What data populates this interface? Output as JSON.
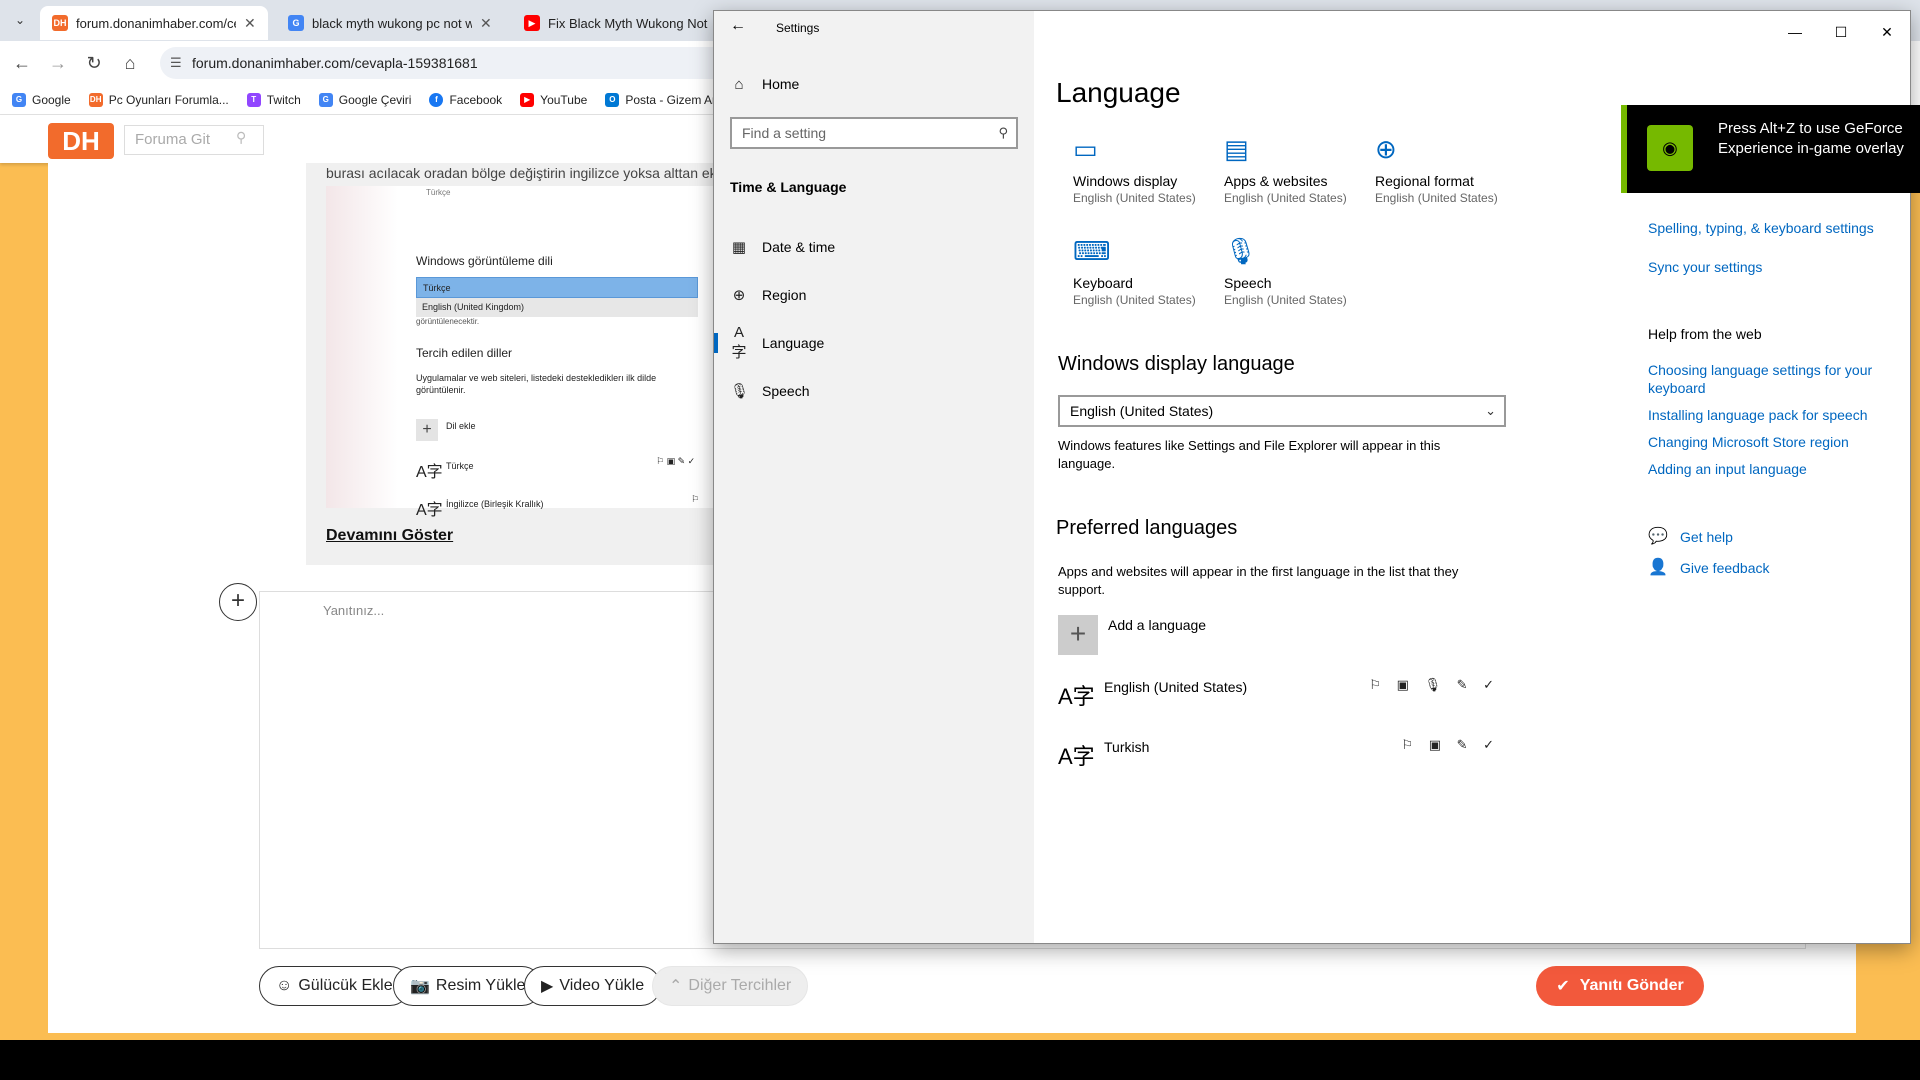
{
  "browser": {
    "tabs": [
      {
        "title": "forum.donanimhaber.com/ceva",
        "favicon": "DH",
        "color": "#f26b2c",
        "active": true
      },
      {
        "title": "black myth wukong pc not wor",
        "favicon": "G",
        "color": "#4285f4",
        "active": false
      },
      {
        "title": "Fix Black Myth Wukong Not La",
        "favicon": "▶",
        "color": "#ff0000",
        "active": false
      }
    ],
    "url": "forum.donanimhaber.com/cevapla-159381681",
    "bookmarks": [
      {
        "label": "Google",
        "icon": "G",
        "color": "#4285f4"
      },
      {
        "label": "Pc Oyunları Forumla...",
        "icon": "DH",
        "color": "#f26b2c"
      },
      {
        "label": "Twitch",
        "icon": "T",
        "color": "#9146ff"
      },
      {
        "label": "Google Çeviri",
        "icon": "G",
        "color": "#4285f4"
      },
      {
        "label": "Facebook",
        "icon": "f",
        "color": "#1877f2"
      },
      {
        "label": "YouTube",
        "icon": "▶",
        "color": "#ff0000"
      },
      {
        "label": "Posta - Gizem Arc",
        "icon": "O",
        "color": "#0078d4"
      }
    ]
  },
  "forum": {
    "logo": "DH",
    "search_placeholder": "Foruma Git",
    "quote_text": "burası acılacak oradan bölge değiştirin ingilizce yoksa alttan ekle y",
    "quote_image": {
      "top_label": "Türkçe",
      "heading1": "Windows görüntüleme dili",
      "selected": "Türkçe",
      "option": "English (United Kingdom)",
      "cut_text": "görüntülenecektir.",
      "heading2": "Tercih edilen diller",
      "desc": "Uygulamalar ve web siteleri, listedeki desteklediklerı ilk dilde görüntülenir.",
      "add": "Dil ekle",
      "lang1": "Türkçe",
      "lang2": "İngilizce (Birleşik Krallık)"
    },
    "show_more": "Devamını Göster",
    "reply_placeholder": "Yanıtınız...",
    "buttons": {
      "emoji": "Gülücük Ekle",
      "image": "Resim Yükle",
      "video": "Video Yükle",
      "more": "Diğer Tercihler",
      "send": "Yanıtı Gönder"
    }
  },
  "settings": {
    "window_title": "Settings",
    "home": "Home",
    "search_placeholder": "Find a setting",
    "section": "Time & Language",
    "nav": [
      {
        "label": "Date & time",
        "icon": "calendar-clock-icon",
        "active": false
      },
      {
        "label": "Region",
        "icon": "globe-icon",
        "active": false
      },
      {
        "label": "Language",
        "icon": "language-icon",
        "active": true
      },
      {
        "label": "Speech",
        "icon": "microphone-icon",
        "active": false
      }
    ],
    "page_title": "Language",
    "tiles": [
      {
        "name": "Windows display",
        "sub": "English (United States)",
        "icon": "monitor-icon"
      },
      {
        "name": "Apps & websites",
        "sub": "English (United States)",
        "icon": "window-icon"
      },
      {
        "name": "Regional format",
        "sub": "English (United States)",
        "icon": "globe-icon"
      },
      {
        "name": "Keyboard",
        "sub": "English (United States)",
        "icon": "keyboard-icon"
      },
      {
        "name": "Speech",
        "sub": "English (United States)",
        "icon": "microphone-icon"
      }
    ],
    "display_language": {
      "heading": "Windows display language",
      "selected": "English (United States)",
      "desc": "Windows features like Settings and File Explorer will appear in this language."
    },
    "preferred": {
      "heading": "Preferred languages",
      "desc": "Apps and websites will appear in the first language in the list that they support.",
      "add_label": "Add a language",
      "languages": [
        {
          "name": "English (United States)",
          "features": "⚐ ▣ 🎙 ✎ ✓"
        },
        {
          "name": "Turkish",
          "features": "⚐ ▣ ✎ ✓"
        }
      ]
    },
    "related_links": [
      "Spelling, typing, & keyboard settings",
      "Sync your settings"
    ],
    "help": {
      "title": "Help from the web",
      "links": [
        "Choosing language settings for your keyboard",
        "Installing language pack for speech",
        "Changing Microsoft Store region",
        "Adding an input language"
      ],
      "get_help": "Get help",
      "give_feedback": "Give feedback"
    }
  },
  "geforce": {
    "message": "Press Alt+Z to use GeForce Experience in-game overlay",
    "accent": "#76b900"
  }
}
